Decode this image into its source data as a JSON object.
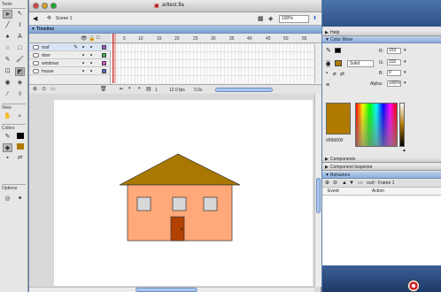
{
  "tools": {
    "section_tools": "Tools",
    "section_view": "View",
    "section_colors": "Colors",
    "section_options": "Options"
  },
  "document": {
    "title": "arttest.fla",
    "scene": "Scene 1",
    "zoom": "100%"
  },
  "timeline": {
    "title": "Timeline",
    "layers": [
      {
        "name": "roof",
        "color": "#9b59d0"
      },
      {
        "name": "door",
        "color": "#3cb44b"
      },
      {
        "name": "windows",
        "color": "#e04fd0"
      },
      {
        "name": "house",
        "color": "#4a6fe0"
      }
    ],
    "frame_numbers": [
      "5",
      "10",
      "15",
      "20",
      "25",
      "30",
      "35",
      "40",
      "45",
      "50",
      "55"
    ],
    "current_frame": "1",
    "fps": "12.0 fps",
    "elapsed": "0.0s"
  },
  "panels": {
    "help": "Help",
    "color_mixer": "Color Mixer",
    "components": "Components",
    "component_inspector": "Component Inspector",
    "behaviors": "Behaviors"
  },
  "color_mixer": {
    "fill_type": "Solid",
    "r_label": "R:",
    "r_value": "153",
    "g_label": "G:",
    "g_value": "102",
    "b_label": "B:",
    "b_value": "0",
    "alpha_label": "Alpha:",
    "alpha_value": "100%",
    "hex": "#996600",
    "swatch_color": "#b07a00"
  },
  "behaviors": {
    "target": "roof : Frame 1",
    "col_event": "Event",
    "col_action": "Action"
  },
  "house_colors": {
    "roof": "#a87800",
    "wall": "#ffa87a",
    "window": "#d8d8d8",
    "door": "#b34200"
  }
}
